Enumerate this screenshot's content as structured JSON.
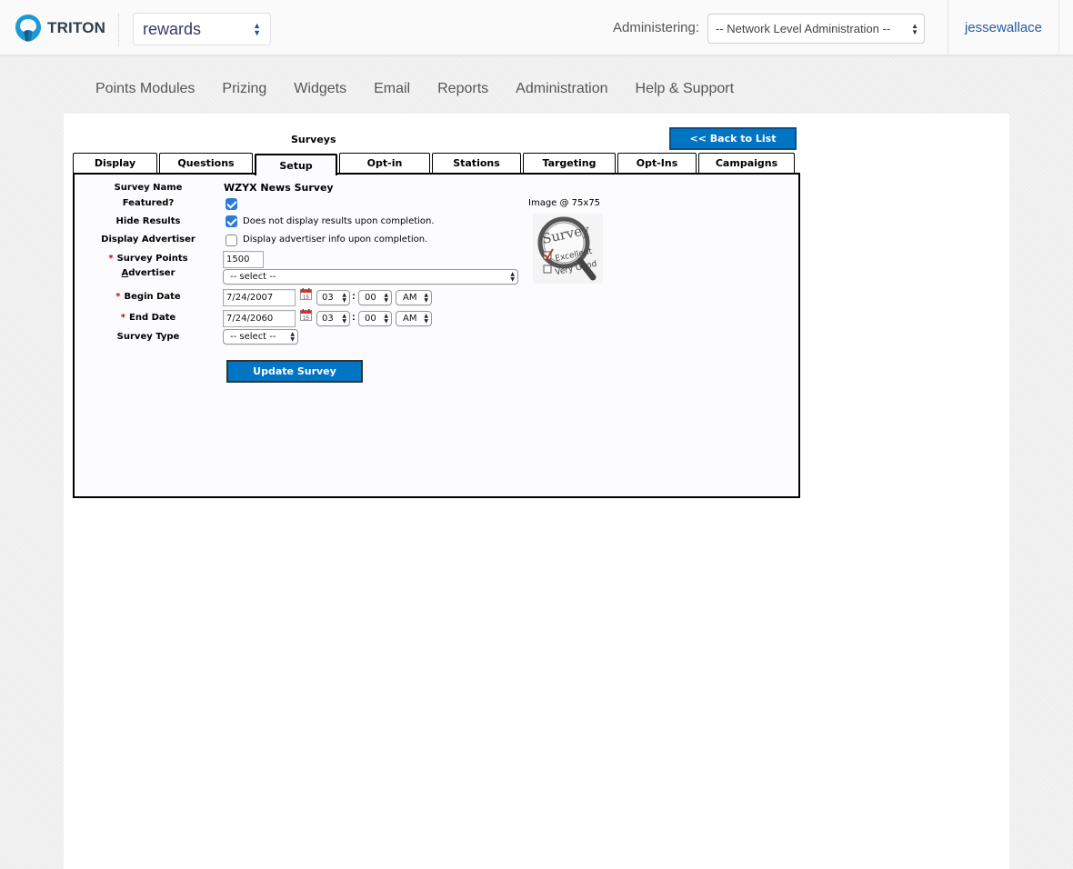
{
  "header": {
    "logo_text": "TRITON",
    "app_select_value": "rewards",
    "admin_label": "Administering:",
    "admin_select_value": "-- Network Level Administration --",
    "username": "jessewallace"
  },
  "nav": {
    "items": [
      "Points Modules",
      "Prizing",
      "Widgets",
      "Email",
      "Reports",
      "Administration",
      "Help & Support"
    ]
  },
  "page": {
    "title": "Surveys",
    "back_button": "<< Back to List"
  },
  "tabs": [
    "Display",
    "Questions",
    "Setup",
    "Opt-in Question",
    "Stations",
    "Targeting",
    "Opt-Ins",
    "Campaigns"
  ],
  "active_tab": "Setup",
  "form": {
    "survey_name_label": "Survey Name",
    "survey_name_value": "WZYX News Survey",
    "featured_label": "Featured?",
    "featured_checked": true,
    "hide_results_label": "Hide Results",
    "hide_results_checked": true,
    "hide_results_text": "Does not display results upon completion.",
    "display_advertiser_label": "Display Advertiser",
    "display_advertiser_checked": false,
    "display_advertiser_text": "Display advertiser info upon completion.",
    "required_mark": "*",
    "survey_points_label": "Survey Points",
    "survey_points_value": "1500",
    "advertiser_label": "Advertiser",
    "advertiser_value": "-- select --",
    "begin_date_label": "Begin Date",
    "begin_date_value": "7/24/2007",
    "begin_hour": "03",
    "begin_minute": "00",
    "begin_ampm": "AM",
    "end_date_label": "End Date",
    "end_date_value": "7/24/2060",
    "end_hour": "03",
    "end_minute": "00",
    "end_ampm": "AM",
    "time_separator": ":",
    "survey_type_label": "Survey Type",
    "survey_type_value": "-- select --",
    "image_label": "Image @ 75x75",
    "thumb_text_1": "Survey",
    "thumb_text_2": "Excellent",
    "thumb_text_3": "Very Good",
    "calendar_day": "15",
    "update_button": "Update Survey"
  },
  "colors": {
    "button_blue": "#0075c4",
    "link_blue": "#2b5b9b",
    "required_red": "#cc0000",
    "checkbox_blue": "#2a7be0"
  }
}
